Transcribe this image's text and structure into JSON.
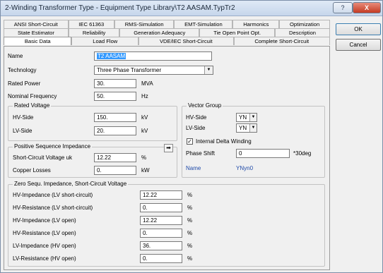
{
  "window": {
    "title": "2-Winding Transformer Type - Equipment Type Library\\T2 AASAM.TypTr2",
    "help_label": "?",
    "close_label": "X"
  },
  "tabs": {
    "row1": [
      "ANSI Short-Circuit",
      "IEC 61363",
      "RMS-Simulation",
      "EMT-Simulation",
      "Harmonics",
      "Optimization"
    ],
    "row2": [
      "State Estimator",
      "Reliability",
      "Generation Adequacy",
      "Tie Open Point Opt.",
      "Description"
    ],
    "row3": [
      "Basic Data",
      "Load Flow",
      "VDE/IEC Short-Circuit",
      "Complete Short-Circuit"
    ]
  },
  "buttons": {
    "ok": "OK",
    "cancel": "Cancel"
  },
  "basic": {
    "name_label": "Name",
    "name_value": "T2 AASAM",
    "technology_label": "Technology",
    "technology_value": "Three Phase Transformer",
    "rated_power_label": "Rated Power",
    "rated_power_value": "30.",
    "rated_power_unit": "MVA",
    "nominal_freq_label": "Nominal Frequency",
    "nominal_freq_value": "50.",
    "nominal_freq_unit": "Hz"
  },
  "rated_voltage": {
    "title": "Rated Voltage",
    "hv_label": "HV-Side",
    "hv_value": "150.",
    "hv_unit": "kV",
    "lv_label": "LV-Side",
    "lv_value": "20.",
    "lv_unit": "kV"
  },
  "vector_group": {
    "title": "Vector Group",
    "hv_label": "HV-Side",
    "hv_value": "YN",
    "lv_label": "LV-Side",
    "lv_value": "YN",
    "delta_label": "Internal Delta Winding",
    "delta_check": "✓",
    "phase_shift_label": "Phase Shift",
    "phase_shift_value": "0",
    "phase_shift_unit": "*30deg",
    "name_label": "Name",
    "name_value": "YNyn0"
  },
  "pos_seq": {
    "title": "Positive Sequence Impedance",
    "uk_label": "Short-Circuit Voltage uk",
    "uk_value": "12.22",
    "uk_unit": "%",
    "cu_label": "Copper Losses",
    "cu_value": "0.",
    "cu_unit": "kW",
    "arrow": "➡"
  },
  "zero_seq": {
    "title": "Zero Sequ. Impedance, Short-Circuit Voltage",
    "rows": [
      {
        "label": "HV-Impedance (LV short-circuit)",
        "value": "12.22",
        "unit": "%"
      },
      {
        "label": "HV-Resistance (LV short-circuit)",
        "value": "0.",
        "unit": "%"
      },
      {
        "label": "HV-Impedance (LV open)",
        "value": "12.22",
        "unit": "%"
      },
      {
        "label": "HV-Resistance (LV open)",
        "value": "0.",
        "unit": "%"
      },
      {
        "label": "LV-Impedance (HV open)",
        "value": "36.",
        "unit": "%"
      },
      {
        "label": "LV-Resistance (HV open)",
        "value": "0.",
        "unit": "%"
      }
    ]
  },
  "colors": {
    "selection": "#3399ff",
    "link_blue": "#1f4aa8",
    "close": "#c43a22"
  }
}
